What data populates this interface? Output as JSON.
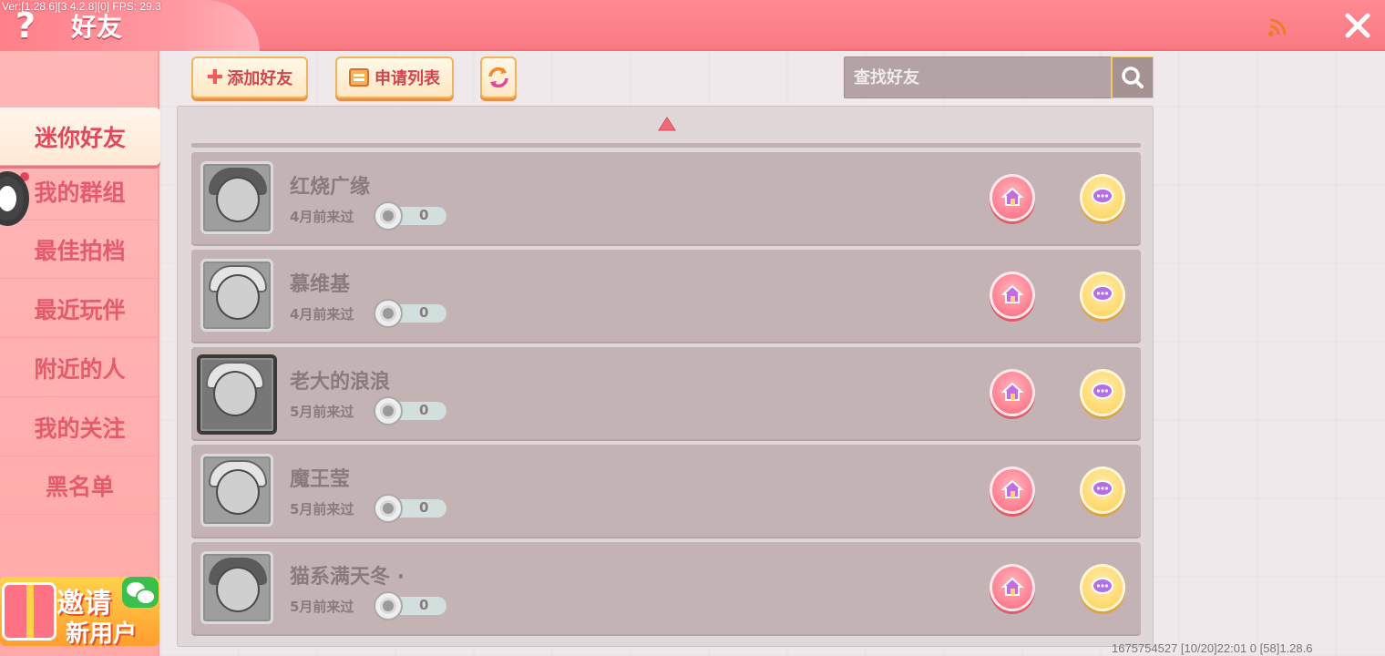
{
  "header": {
    "version_text": "Ver:[1.28.6][3.4.2.8][0] FPS: 29.3",
    "help_label": "?",
    "title": "好友"
  },
  "sidebar": {
    "items": [
      {
        "label": "迷你好友",
        "active": true
      },
      {
        "label": "我的群组"
      },
      {
        "label": "最佳拍档"
      },
      {
        "label": "最近玩伴"
      },
      {
        "label": "附近的人"
      },
      {
        "label": "我的关注"
      },
      {
        "label": "黑名单"
      }
    ],
    "invite": {
      "line1": "邀请",
      "line2": "新用户"
    }
  },
  "toolbar": {
    "add_friend_label": "添加好友",
    "apply_list_label": "申请列表"
  },
  "search": {
    "placeholder": "查找好友",
    "value": ""
  },
  "friends": [
    {
      "name": "红烧广缘",
      "last_seen": "4月前来过",
      "count": "0"
    },
    {
      "name": "慕维基",
      "last_seen": "4月前来过",
      "count": "0"
    },
    {
      "name": "老大的浪浪",
      "last_seen": "5月前来过",
      "count": "0"
    },
    {
      "name": "魔王莹",
      "last_seen": "5月前来过",
      "count": "0"
    },
    {
      "name": "猫系满天冬 ·",
      "last_seen": "5月前来过",
      "count": "0"
    }
  ],
  "footer": {
    "info": "1675754527    [10/20]22:01 0   [58]1.28.6"
  },
  "colors": {
    "header": "#f97a83",
    "sidebar": "#ffaaa9",
    "accent_text": "#e45c6c",
    "row_bg": "#c4b3b4"
  },
  "icons": [
    "help-icon",
    "signal-icon",
    "close-icon",
    "plus-icon",
    "list-icon",
    "refresh-icon",
    "search-icon",
    "flower-icon",
    "home-icon",
    "chat-icon",
    "wechat-icon",
    "gift-icon",
    "arrow-up-icon"
  ]
}
